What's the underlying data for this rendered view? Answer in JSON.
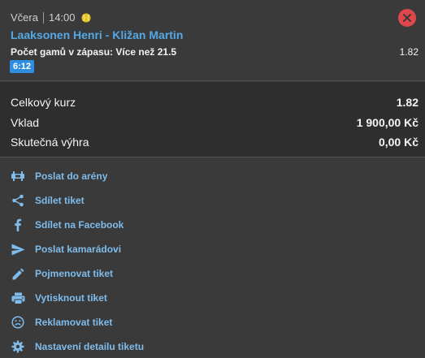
{
  "colors": {
    "link": "#55a8e6",
    "action_text": "#7fbcec",
    "close_bg": "#e0474c",
    "badge_bg": "#2f8ee0",
    "ball": "#e6c21e"
  },
  "ticket": {
    "day": "Včera",
    "time": "14:00",
    "sport_icon": "tennis-ball-icon",
    "match": "Laaksonen Henri - Kližan Martin",
    "market": "Počet gamů v zápasu: Více než 21.5",
    "odds": "1.82",
    "score_badge": "6:12"
  },
  "summary": {
    "total_odds_label": "Celkový kurz",
    "total_odds_value": "1.82",
    "stake_label": "Vklad",
    "stake_value": "1 900,00 Kč",
    "win_label": "Skutečná výhra",
    "win_value": "0,00 Kč"
  },
  "actions": [
    {
      "label": "Poslat do arény",
      "icon": "arena-icon"
    },
    {
      "label": "Sdílet tiket",
      "icon": "share-icon"
    },
    {
      "label": "Sdílet na Facebook",
      "icon": "facebook-icon"
    },
    {
      "label": "Poslat kamarádovi",
      "icon": "send-icon"
    },
    {
      "label": "Pojmenovat tiket",
      "icon": "pencil-icon"
    },
    {
      "label": "Vytisknout tiket",
      "icon": "printer-icon"
    },
    {
      "label": "Reklamovat tiket",
      "icon": "sad-face-icon"
    },
    {
      "label": "Nastavení detailu tiketu",
      "icon": "gear-icon"
    }
  ]
}
